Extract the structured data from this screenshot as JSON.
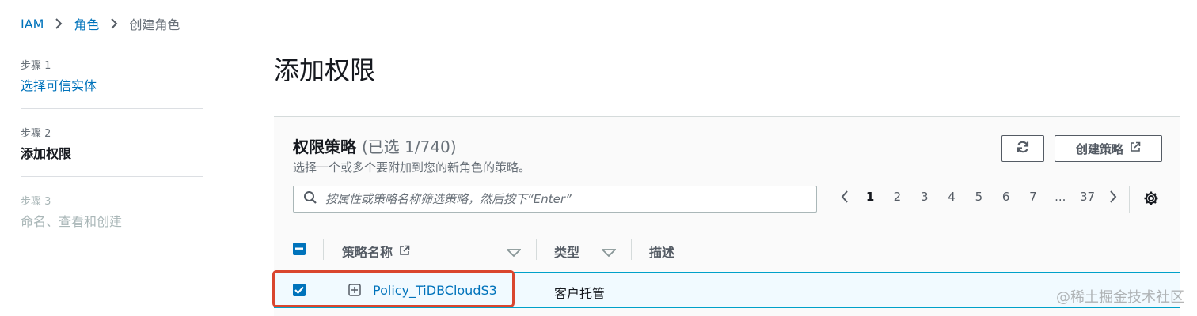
{
  "breadcrumb": {
    "items": [
      "IAM",
      "角色"
    ],
    "current": "创建角色"
  },
  "steps": [
    {
      "num": "步骤 1",
      "label": "选择可信实体",
      "state": "link"
    },
    {
      "num": "步骤 2",
      "label": "添加权限",
      "state": "active"
    },
    {
      "num": "步骤 3",
      "label": "命名、查看和创建",
      "state": "disabled"
    }
  ],
  "page": {
    "title": "添加权限"
  },
  "policies": {
    "title": "权限策略",
    "count": "(已选 1/740)",
    "description": "选择一个或多个要附加到您的新角色的策略。",
    "refresh_icon": "refresh-icon",
    "create_button": "创建策略",
    "search_placeholder": "按属性或策略名称筛选策略，然后按下“Enter”",
    "pagination": {
      "pages": [
        "1",
        "2",
        "3",
        "4",
        "5",
        "6",
        "7",
        "...",
        "37"
      ],
      "current": "1"
    },
    "columns": {
      "name": "策略名称",
      "type": "类型",
      "description": "描述"
    },
    "rows": [
      {
        "name": "Policy_TiDBCloudS3",
        "type": "客户托管",
        "selected": true
      }
    ]
  },
  "watermark": "@稀土掘金技术社区",
  "colors": {
    "link": "#0073bb",
    "highlight": "#d9462f",
    "row_selected_bg": "#f1faff"
  }
}
